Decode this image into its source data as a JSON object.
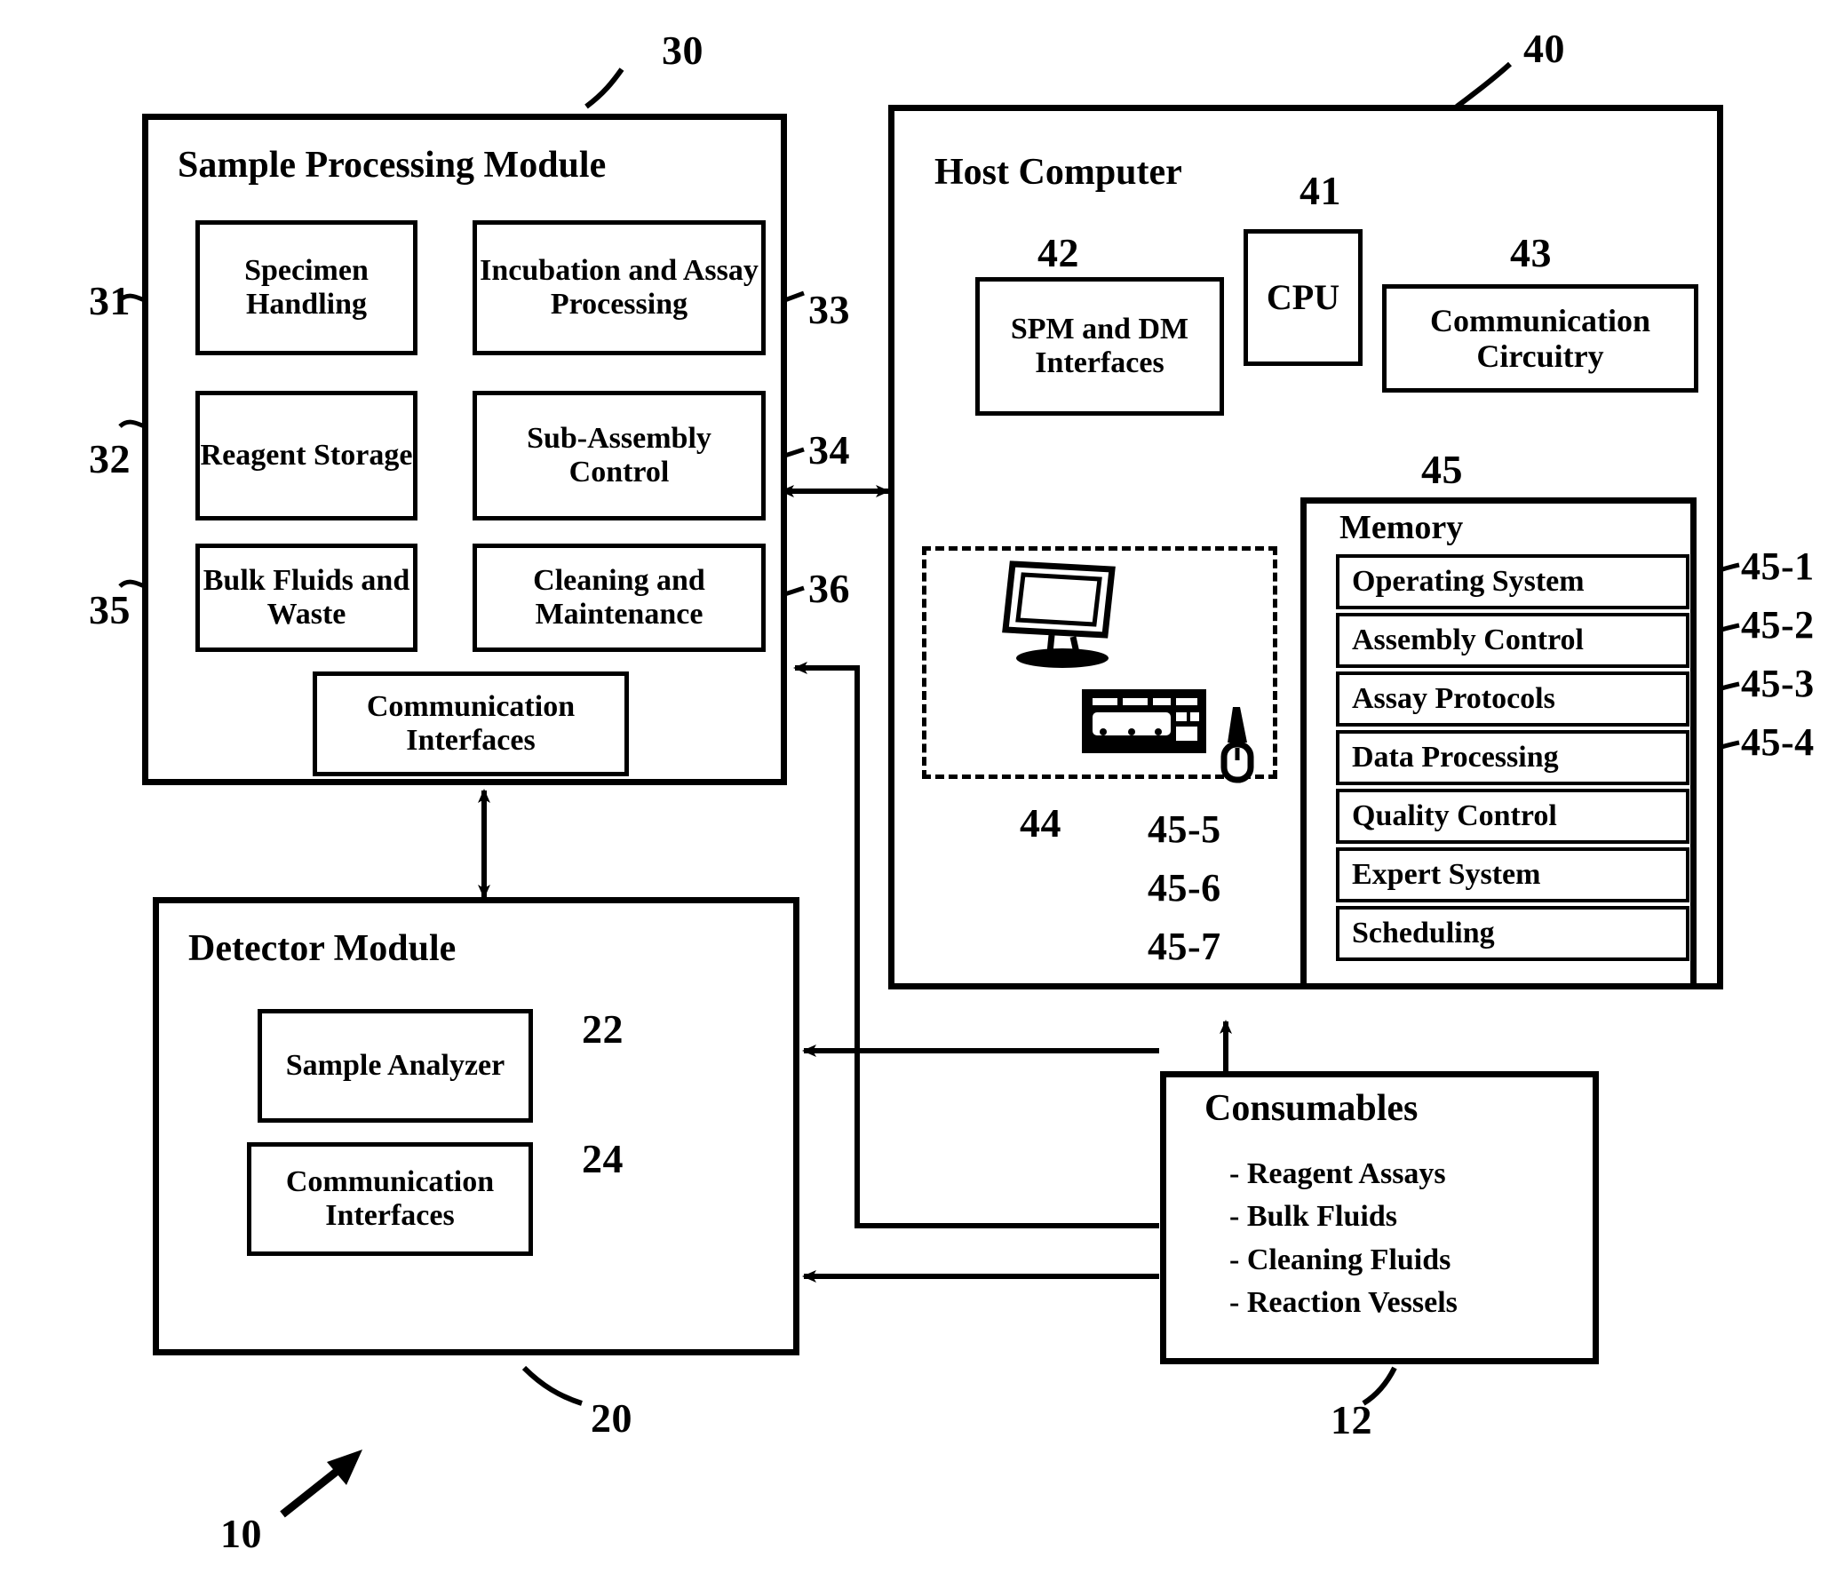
{
  "figure": {
    "system_ref": "10",
    "arrow_icon": "system-pointer-arrow"
  },
  "sample_processing_module": {
    "title": "Sample Processing Module",
    "ref": "30",
    "blocks": [
      {
        "label": "Specimen\nHandling",
        "ref": "31"
      },
      {
        "label": "Incubation and\nAssay Processing",
        "ref": "33"
      },
      {
        "label": "Reagent\nStorage",
        "ref": "32"
      },
      {
        "label": "Sub-Assembly\nControl",
        "ref": "34"
      },
      {
        "label": "Bulk Fluids\nand Waste",
        "ref": "35"
      },
      {
        "label": "Cleaning and\nMaintenance",
        "ref": "36"
      },
      {
        "label": "Communication\nInterfaces",
        "ref": ""
      }
    ],
    "block_labels": {
      "specimen_handling": "Specimen Handling",
      "incubation_assay": "Incubation and Assay Processing",
      "reagent_storage": "Reagent Storage",
      "sub_assembly_control": "Sub-Assembly Control",
      "bulk_fluids": "Bulk Fluids and Waste",
      "cleaning_maintenance": "Cleaning and Maintenance",
      "communication_interfaces": "Communication Interfaces"
    }
  },
  "host_computer": {
    "title": "Host Computer",
    "ref": "40",
    "cpu": {
      "label": "CPU",
      "ref": "41"
    },
    "spm_dm_interfaces": {
      "label": "SPM and DM\nInterfaces",
      "ref": "42"
    },
    "communication_circuitry": {
      "label": "Communication\nCircuitry",
      "ref": "43"
    },
    "peripherals": {
      "ref": "44",
      "icons": [
        "monitor-icon",
        "keyboard-icon",
        "mouse-icon"
      ]
    },
    "memory": {
      "title": "Memory",
      "ref": "45",
      "items": [
        {
          "label": "Operating System",
          "ref": "45-1"
        },
        {
          "label": "Assembly Control",
          "ref": "45-2"
        },
        {
          "label": "Assay Protocols",
          "ref": "45-3"
        },
        {
          "label": "Data Processing",
          "ref": "45-4"
        },
        {
          "label": "Quality Control",
          "ref": "45-5"
        },
        {
          "label": "Expert System",
          "ref": "45-6"
        },
        {
          "label": "Scheduling",
          "ref": "45-7"
        }
      ]
    }
  },
  "detector_module": {
    "title": "Detector Module",
    "ref": "20",
    "blocks": [
      {
        "label": "Sample\nAnalyzer",
        "ref": "22"
      },
      {
        "label": "Communication\nInterfaces",
        "ref": "24"
      }
    ],
    "block_labels": {
      "sample_analyzer": "Sample Analyzer",
      "communication_interfaces": "Communication Interfaces"
    }
  },
  "consumables": {
    "title": "Consumables",
    "ref": "12",
    "items": [
      "- Reagent Assays",
      "- Bulk Fluids",
      "- Cleaning Fluids",
      "- Reaction Vessels"
    ]
  },
  "colors": {
    "ink": "#000000",
    "paper": "#ffffff"
  }
}
